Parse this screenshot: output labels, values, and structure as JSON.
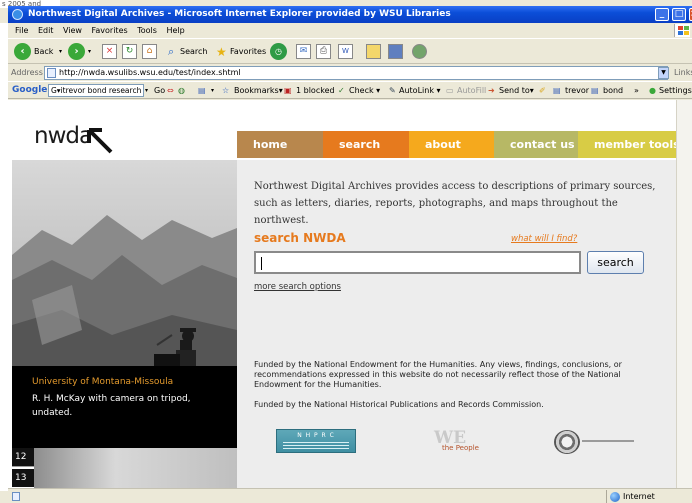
{
  "window": {
    "title": "Northwest Digital Archives - Microsoft Internet Explorer provided by WSU Libraries"
  },
  "desktop_text": "s 2005 and",
  "menu": [
    "File",
    "Edit",
    "View",
    "Favorites",
    "Tools",
    "Help"
  ],
  "toolbar": {
    "back": "Back",
    "search": "Search",
    "favorites": "Favorites"
  },
  "address": {
    "label": "Address",
    "url": "http://nwda.wsulibs.wsu.edu/test/index.shtml",
    "links": "Links"
  },
  "google_bar": {
    "brand": "Google",
    "query": "G▾itrevor bond research",
    "go": "Go",
    "bookmarks": "Bookmarks▾",
    "blocked": "1 blocked",
    "check": "Check ▾",
    "autolink": "AutoLink ▾",
    "autofill": "AutoFill",
    "send_to": "Send to▾",
    "chip1": "trevor",
    "chip2": "bond",
    "more": "»",
    "settings": "Settings▾"
  },
  "site": {
    "logo": "nwda",
    "nav": [
      "home",
      "search",
      "about",
      "contact us",
      "member tools"
    ],
    "nav_colors": [
      "#b8874d",
      "#e67a1e",
      "#f5a91d",
      "#b7b865",
      "#d8cc45"
    ],
    "intro": "Northwest Digital Archives provides access to descriptions of primary sources, such as letters, diaries, reports, photographs, and maps throughout the northwest.",
    "search_title": "search NWDA",
    "what_find": "what will I find?",
    "search_value": "",
    "search_button": "search",
    "more_options": "more search options",
    "caption_source": "University of Montana-Missoula",
    "caption_text": "R. H. McKay with camera on tripod, undated.",
    "page_numbers": [
      "12",
      "13"
    ],
    "funding1": "Funded by the National Endowment for the Humanities. Any views, findings, conclusions, or recommendations expressed in this website do not necessarily reflect those of the National Endowment for the Humanities.",
    "funding2": "Funded by the National Historical Publications and Records Commission.",
    "nhprc_logo_text": "N H P R C",
    "we_logo_text": "the People"
  },
  "status": {
    "zone": "Internet"
  }
}
